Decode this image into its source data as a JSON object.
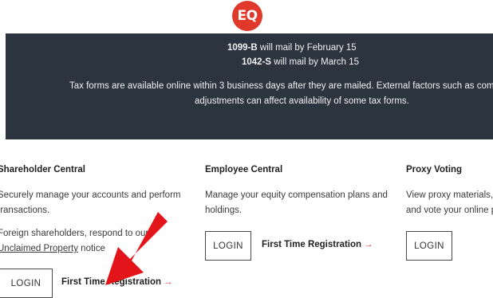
{
  "logo": {
    "text": "EQ",
    "color": "#e0392b"
  },
  "banner": {
    "form1_bold": "1099-B",
    "form1_text": " will mail by February 15",
    "form2_bold": "1042-S",
    "form2_text": " will mail by March 15",
    "note_line1": "Tax forms are available online within 3 business days after they are mailed. External factors such as comp",
    "note_line2": "adjustments can affect availability of some tax forms.",
    "bg_color": "#2c3440"
  },
  "shareholder": {
    "title": "Shareholder Central",
    "desc_line1": "Securely manage your accounts and perform",
    "desc_line2": "transactions.",
    "foreign_line1": "Foreign shareholders, respond to our",
    "unclaimed_link": "Unclaimed Property",
    "notice_suffix": " notice",
    "login_label": "LOGIN",
    "register_label": "First Time Registration"
  },
  "employee": {
    "title": "Employee Central",
    "desc_line1": "Manage your equity compensation plans and",
    "desc_line2": "holdings.",
    "login_label": "LOGIN",
    "register_label": "First Time Registration"
  },
  "proxy": {
    "title": "Proxy Voting",
    "desc_line1": "View proxy materials,",
    "desc_line2": "and vote your online p",
    "login_label": "LOGIN"
  },
  "arrow_glyph": "→",
  "annotation_arrow": {
    "color": "#e4141b",
    "icon": "red-pointer-arrow"
  }
}
